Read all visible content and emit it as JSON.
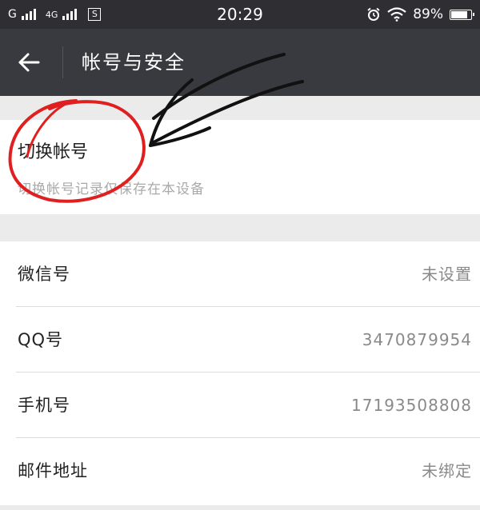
{
  "status_bar": {
    "carrier": "G",
    "network": "4G",
    "sim_label": "S",
    "time": "20:29",
    "battery": "89%",
    "battery_level": 0.89,
    "icons": [
      "signal-icon",
      "signal-icon",
      "sim-icon",
      "alarm-icon",
      "wifi-icon",
      "battery-icon"
    ]
  },
  "header": {
    "back_icon": "back-arrow-icon",
    "title": "帐号与安全"
  },
  "switch_account": {
    "title": "切换帐号",
    "description": "切换帐号记录仅保存在本设备"
  },
  "info_rows": [
    {
      "label": "微信号",
      "value": "未设置"
    },
    {
      "label": "QQ号",
      "value": "3470879954"
    },
    {
      "label": "手机号",
      "value": "17193508808"
    },
    {
      "label": "邮件地址",
      "value": "未绑定"
    }
  ],
  "colors": {
    "status_bar_bg": "#2f2f33",
    "title_bar_bg": "#393a3f",
    "page_bg": "#ebebeb",
    "annotation_circle": "#e02020",
    "annotation_arrows": "#111111"
  }
}
